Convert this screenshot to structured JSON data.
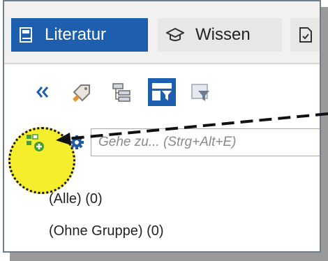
{
  "tabs": [
    {
      "label": "Literatur",
      "icon": "book-icon",
      "active": true
    },
    {
      "label": "Wissen",
      "icon": "graduation-cap-icon",
      "active": false
    },
    {
      "label": "",
      "icon": "document-icon",
      "active": false
    }
  ],
  "toolbar": {
    "icons": [
      "collapse-double-chevron-icon",
      "tag-edit-icon",
      "tree-structure-icon",
      "filter-grid-icon",
      "filter-icon"
    ]
  },
  "search": {
    "placeholder": "Gehe zu... (Strg+Alt+E)"
  },
  "groups": [
    {
      "label": "(Alle) (0)"
    },
    {
      "label": "(Ohne Gruppe) (0)"
    }
  ],
  "colors": {
    "accent": "#1d5fae",
    "highlight": "#f5ee2c",
    "add_green": "#4a9b35"
  }
}
